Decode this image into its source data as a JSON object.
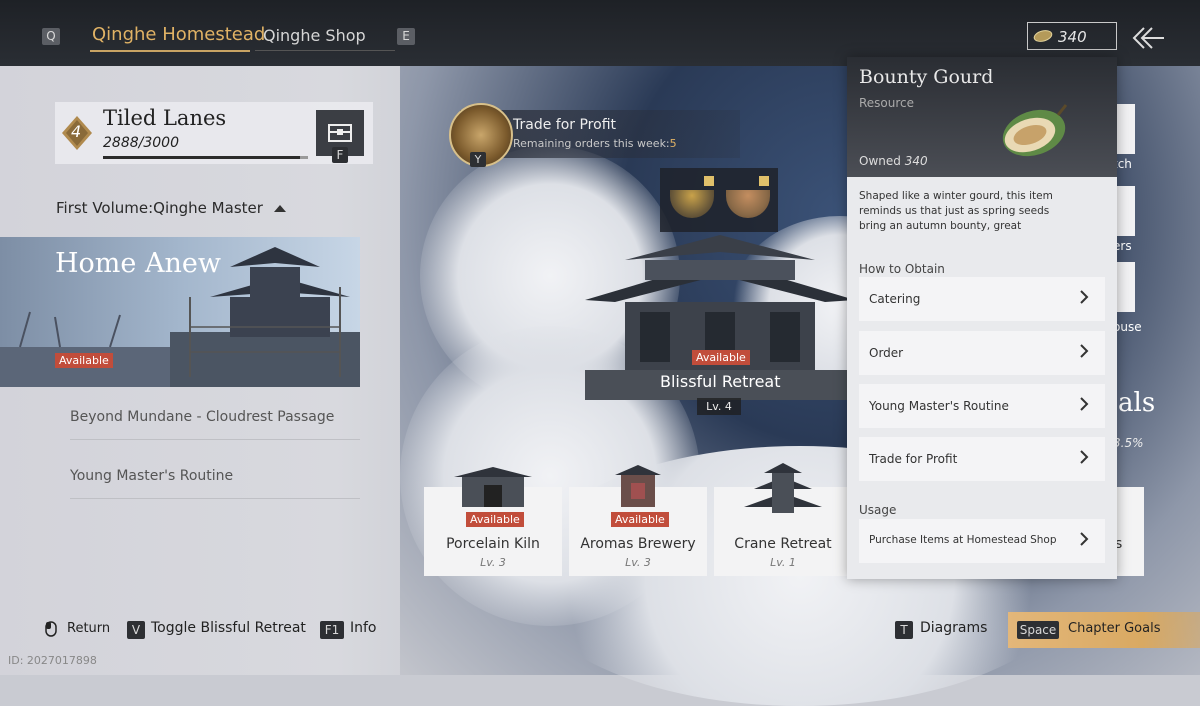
{
  "topbar": {
    "key_left": "Q",
    "tab_active": "Qinghe Homestead",
    "tab_inactive": "Qinghe Shop",
    "key_right": "E",
    "currency_value": "340"
  },
  "area": {
    "level": "4",
    "name": "Tiled Lanes",
    "progress_text": "2888/3000",
    "progress_fraction": 0.962,
    "chest_key": "F"
  },
  "volume_label": "First Volume:Qinghe Master",
  "chapters": {
    "current_title": "Home Anew",
    "current_badge": "Available",
    "items": [
      "Beyond Mundane - Cloudrest Passage",
      "Young Master's Routine"
    ]
  },
  "trade": {
    "key": "Y",
    "title": "Trade for Profit",
    "subtitle_prefix": "Remaining orders this week:",
    "remaining": "5"
  },
  "retreat": {
    "badge": "Available",
    "name": "Blissful Retreat",
    "level": "Lv. 4"
  },
  "buildings": [
    {
      "name": "Porcelain Kiln",
      "level": "Lv. 3",
      "badge": "Available"
    },
    {
      "name": "Aromas Brewery",
      "level": "Lv. 3",
      "badge": "Available"
    },
    {
      "name": "Crane Retreat",
      "level": "Lv. 1",
      "badge": ""
    }
  ],
  "popup": {
    "name": "Bounty Gourd",
    "type": "Resource",
    "owned_label": "Owned",
    "owned_value": "340",
    "description": "Shaped like a winter gourd, this item reminds us that just as spring seeds bring an autumn bounty, great",
    "obtain_header": "How to Obtain",
    "obtain": [
      "Catering",
      "Order",
      "Young Master's Routine",
      "Trade for Profit"
    ],
    "usage_header": "Usage",
    "usage": [
      "Purchase Items at Homestead Shop"
    ]
  },
  "side": {
    "label1": "tch",
    "label2": "ers",
    "label3": "ouse",
    "goals": "als",
    "pct": "3.5%",
    "s": "s"
  },
  "bottom": {
    "return": "Return",
    "toggle_key": "V",
    "toggle": "Toggle Blissful Retreat",
    "info_key": "F1",
    "info": "Info",
    "diagrams_key": "T",
    "diagrams": "Diagrams",
    "goals_key": "Space",
    "goals": "Chapter Goals"
  },
  "uid": "ID: 2027017898",
  "colors": {
    "accent_gold": "#e0b265",
    "badge_red": "#c14d3b"
  }
}
